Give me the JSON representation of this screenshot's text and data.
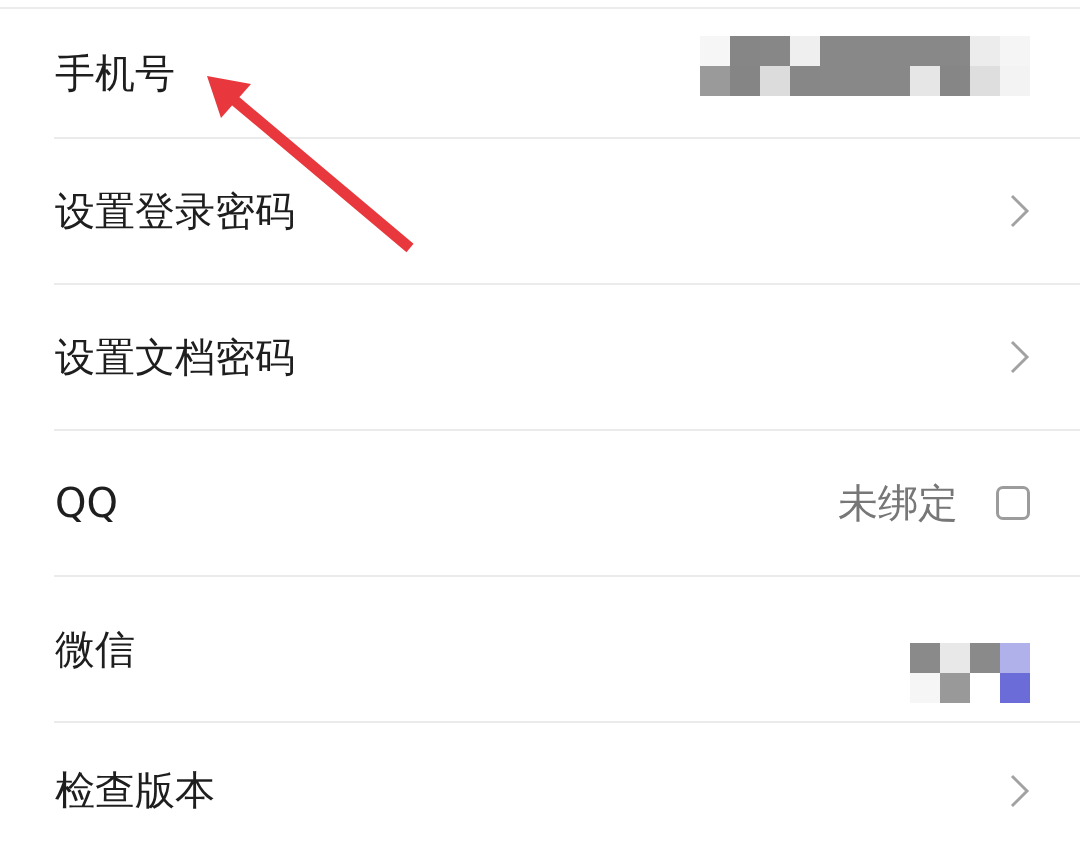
{
  "rows": [
    {
      "label": "手机号",
      "kind": "masked",
      "pointed": true
    },
    {
      "label": "设置登录密码",
      "kind": "link",
      "pointed": false
    },
    {
      "label": "设置文档密码",
      "kind": "link",
      "pointed": false
    },
    {
      "label": "QQ",
      "kind": "bind",
      "status": "未绑定",
      "checked": false,
      "pointed": false
    },
    {
      "label": "微信",
      "kind": "masked_avatar",
      "pointed": false
    },
    {
      "label": "检查版本",
      "kind": "link",
      "pointed": false
    }
  ]
}
